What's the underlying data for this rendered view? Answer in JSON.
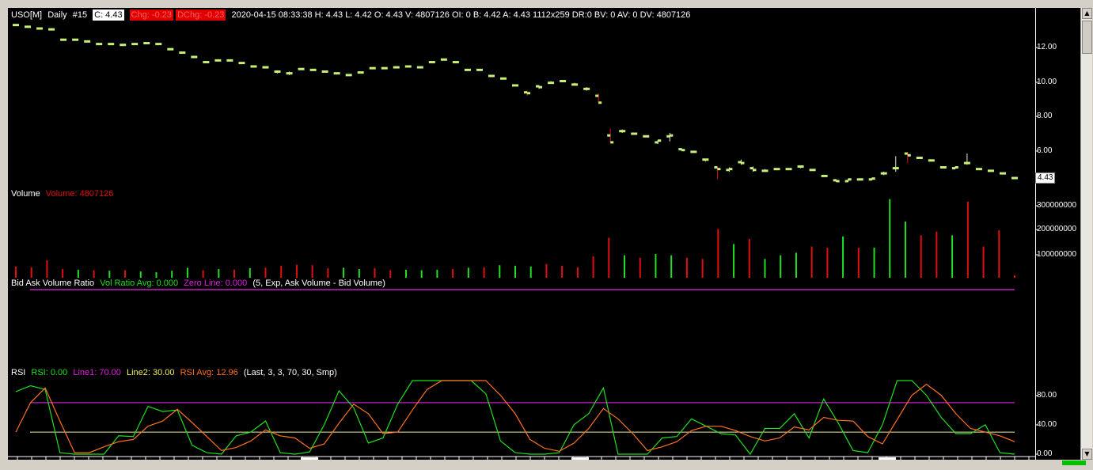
{
  "header": {
    "symbol": "USO[M]",
    "interval": "Daily",
    "number": "#15",
    "close": "C: 4.43",
    "chg": "Chg: -0.23",
    "dchg": "DChg: -0.23",
    "details": "2020-04-15 08:33:38 H: 4.43 L: 4.42 O: 4.43 V: 4807126 OI: 0 B: 4.42 A: 4.43 1112x259 DR:0 BV: 0 AV: 0 DV: 4807126"
  },
  "volume_header": {
    "title": "Volume",
    "value": "Volume: 4807126"
  },
  "bav_header": {
    "title": "Bid Ask Volume Ratio",
    "avg": "Vol Ratio Avg: 0.000",
    "zero": "Zero Line: 0.000",
    "params": "(5, Exp, Ask Volume - Bid Volume)"
  },
  "rsi_header": {
    "title": "RSI",
    "rsi": "RSI: 0.00",
    "line1": "Line1: 70.00",
    "line2": "Line2: 30.00",
    "avg": "RSI Avg: 12.96",
    "params": "(Last, 3, 3, 70, 30, Smp)"
  },
  "price_axis": {
    "labels": [
      "12.00",
      "10.00",
      "8.00",
      "6.00"
    ],
    "last": "4.43"
  },
  "volume_axis": {
    "labels": [
      "300000000",
      "200000000",
      "100000000"
    ]
  },
  "rsi_axis": {
    "labels": [
      "80.00",
      "40.00",
      "0.00"
    ]
  },
  "colors": {
    "bars": "#c8f078",
    "vol_up": "#20e020",
    "vol_down": "#e01010",
    "magenta": "#c020c0",
    "line2": "#f0f0a0",
    "rsi": "#20e020",
    "rsi_avg": "#ff7020"
  },
  "chart_data": [
    {
      "type": "ohlc",
      "name": "USO[M] Daily",
      "ylim": [
        4.0,
        13.6
      ],
      "values": [
        {
          "o": 13.3,
          "h": 13.35,
          "l": 13.25,
          "c": 13.3
        },
        {
          "o": 13.2,
          "h": 13.25,
          "l": 13.15,
          "c": 13.2
        },
        {
          "o": 13.1,
          "h": 13.15,
          "l": 13.05,
          "c": 13.1
        },
        {
          "o": 13.05,
          "h": 13.1,
          "l": 13.0,
          "c": 13.05
        },
        {
          "o": 12.45,
          "h": 12.5,
          "l": 12.4,
          "c": 12.45
        },
        {
          "o": 12.45,
          "h": 12.5,
          "l": 12.4,
          "c": 12.45
        },
        {
          "o": 12.35,
          "h": 12.4,
          "l": 12.3,
          "c": 12.35
        },
        {
          "o": 12.2,
          "h": 12.25,
          "l": 12.15,
          "c": 12.2
        },
        {
          "o": 12.2,
          "h": 12.25,
          "l": 12.15,
          "c": 12.2
        },
        {
          "o": 12.15,
          "h": 12.2,
          "l": 12.1,
          "c": 12.15
        },
        {
          "o": 12.2,
          "h": 12.25,
          "l": 12.15,
          "c": 12.2
        },
        {
          "o": 12.25,
          "h": 12.3,
          "l": 12.2,
          "c": 12.25
        },
        {
          "o": 12.2,
          "h": 12.25,
          "l": 12.15,
          "c": 12.2
        },
        {
          "o": 11.9,
          "h": 11.95,
          "l": 11.85,
          "c": 11.9
        },
        {
          "o": 11.7,
          "h": 11.75,
          "l": 11.65,
          "c": 11.7
        },
        {
          "o": 11.45,
          "h": 11.5,
          "l": 11.4,
          "c": 11.45
        },
        {
          "o": 11.15,
          "h": 11.2,
          "l": 11.1,
          "c": 11.15
        },
        {
          "o": 11.25,
          "h": 11.3,
          "l": 11.2,
          "c": 11.25
        },
        {
          "o": 11.25,
          "h": 11.3,
          "l": 11.2,
          "c": 11.25
        },
        {
          "o": 11.1,
          "h": 11.15,
          "l": 11.05,
          "c": 11.1
        },
        {
          "o": 10.9,
          "h": 10.95,
          "l": 10.85,
          "c": 10.9
        },
        {
          "o": 10.85,
          "h": 10.9,
          "l": 10.8,
          "c": 10.85
        },
        {
          "o": 10.6,
          "h": 10.65,
          "l": 10.5,
          "c": 10.6
        },
        {
          "o": 10.5,
          "h": 10.6,
          "l": 10.4,
          "c": 10.5
        },
        {
          "o": 10.75,
          "h": 10.8,
          "l": 10.7,
          "c": 10.75
        },
        {
          "o": 10.7,
          "h": 10.75,
          "l": 10.65,
          "c": 10.7
        },
        {
          "o": 10.6,
          "h": 10.65,
          "l": 10.55,
          "c": 10.6
        },
        {
          "o": 10.5,
          "h": 10.55,
          "l": 10.45,
          "c": 10.5
        },
        {
          "o": 10.4,
          "h": 10.45,
          "l": 10.35,
          "c": 10.4
        },
        {
          "o": 10.55,
          "h": 10.6,
          "l": 10.5,
          "c": 10.55
        },
        {
          "o": 10.8,
          "h": 10.85,
          "l": 10.75,
          "c": 10.8
        },
        {
          "o": 10.8,
          "h": 10.85,
          "l": 10.75,
          "c": 10.8
        },
        {
          "o": 10.85,
          "h": 10.9,
          "l": 10.8,
          "c": 10.85
        },
        {
          "o": 10.9,
          "h": 10.95,
          "l": 10.85,
          "c": 10.9
        },
        {
          "o": 10.85,
          "h": 10.9,
          "l": 10.8,
          "c": 10.85
        },
        {
          "o": 11.15,
          "h": 11.2,
          "l": 11.1,
          "c": 11.15
        },
        {
          "o": 11.3,
          "h": 11.35,
          "l": 11.25,
          "c": 11.3
        },
        {
          "o": 11.15,
          "h": 11.2,
          "l": 11.1,
          "c": 11.15
        },
        {
          "o": 10.7,
          "h": 10.75,
          "l": 10.65,
          "c": 10.7
        },
        {
          "o": 10.7,
          "h": 10.75,
          "l": 10.65,
          "c": 10.7
        },
        {
          "o": 10.35,
          "h": 10.4,
          "l": 10.3,
          "c": 10.35
        },
        {
          "o": 10.2,
          "h": 10.25,
          "l": 10.15,
          "c": 10.2
        },
        {
          "o": 9.8,
          "h": 9.85,
          "l": 9.75,
          "c": 9.8
        },
        {
          "o": 9.4,
          "h": 9.5,
          "l": 9.2,
          "c": 9.35
        },
        {
          "o": 9.75,
          "h": 9.8,
          "l": 9.6,
          "c": 9.7
        },
        {
          "o": 9.95,
          "h": 10.05,
          "l": 9.9,
          "c": 9.95
        },
        {
          "o": 10.05,
          "h": 10.1,
          "l": 10.0,
          "c": 10.05
        },
        {
          "o": 9.85,
          "h": 9.95,
          "l": 9.8,
          "c": 9.85
        },
        {
          "o": 9.6,
          "h": 9.7,
          "l": 9.5,
          "c": 9.6
        },
        {
          "o": 9.2,
          "h": 9.35,
          "l": 8.8,
          "c": 8.8
        },
        {
          "o": 6.9,
          "h": 7.3,
          "l": 6.5,
          "c": 6.5
        },
        {
          "o": 7.15,
          "h": 7.25,
          "l": 7.05,
          "c": 7.15
        },
        {
          "o": 7.0,
          "h": 7.05,
          "l": 6.95,
          "c": 7.0
        },
        {
          "o": 6.85,
          "h": 6.9,
          "l": 6.8,
          "c": 6.85
        },
        {
          "o": 6.5,
          "h": 6.65,
          "l": 6.4,
          "c": 6.6
        },
        {
          "o": 6.85,
          "h": 7.05,
          "l": 6.55,
          "c": 6.9
        },
        {
          "o": 6.1,
          "h": 6.15,
          "l": 6.0,
          "c": 6.05
        },
        {
          "o": 5.95,
          "h": 6.0,
          "l": 5.9,
          "c": 5.95
        },
        {
          "o": 5.5,
          "h": 5.55,
          "l": 5.4,
          "c": 5.5
        },
        {
          "o": 5.05,
          "h": 5.1,
          "l": 4.35,
          "c": 4.95
        },
        {
          "o": 4.9,
          "h": 5.05,
          "l": 4.8,
          "c": 4.95
        },
        {
          "o": 5.35,
          "h": 5.5,
          "l": 5.2,
          "c": 5.3
        },
        {
          "o": 5.0,
          "h": 5.1,
          "l": 4.8,
          "c": 4.9
        },
        {
          "o": 4.85,
          "h": 4.95,
          "l": 4.8,
          "c": 4.85
        },
        {
          "o": 4.95,
          "h": 5.0,
          "l": 4.9,
          "c": 4.95
        },
        {
          "o": 4.95,
          "h": 5.0,
          "l": 4.9,
          "c": 4.95
        },
        {
          "o": 5.1,
          "h": 5.15,
          "l": 5.0,
          "c": 5.1
        },
        {
          "o": 4.9,
          "h": 4.95,
          "l": 4.85,
          "c": 4.9
        },
        {
          "o": 4.55,
          "h": 4.6,
          "l": 4.5,
          "c": 4.55
        },
        {
          "o": 4.3,
          "h": 4.35,
          "l": 4.2,
          "c": 4.25
        },
        {
          "o": 4.25,
          "h": 4.4,
          "l": 4.2,
          "c": 4.35
        },
        {
          "o": 4.35,
          "h": 4.4,
          "l": 4.3,
          "c": 4.35
        },
        {
          "o": 4.35,
          "h": 4.45,
          "l": 4.3,
          "c": 4.4
        },
        {
          "o": 4.7,
          "h": 4.8,
          "l": 4.6,
          "c": 4.7
        },
        {
          "o": 5.0,
          "h": 5.7,
          "l": 4.8,
          "c": 5.0
        },
        {
          "o": 5.85,
          "h": 5.95,
          "l": 5.3,
          "c": 5.75
        },
        {
          "o": 5.6,
          "h": 5.65,
          "l": 5.55,
          "c": 5.6
        },
        {
          "o": 5.45,
          "h": 5.5,
          "l": 5.4,
          "c": 5.45
        },
        {
          "o": 5.05,
          "h": 5.1,
          "l": 5.0,
          "c": 5.05
        },
        {
          "o": 5.0,
          "h": 5.1,
          "l": 4.95,
          "c": 5.05
        },
        {
          "o": 5.3,
          "h": 5.85,
          "l": 5.2,
          "c": 5.3
        },
        {
          "o": 4.95,
          "h": 5.0,
          "l": 4.9,
          "c": 4.95
        },
        {
          "o": 4.85,
          "h": 4.9,
          "l": 4.8,
          "c": 4.85
        },
        {
          "o": 4.7,
          "h": 4.75,
          "l": 4.65,
          "c": 4.7
        },
        {
          "o": 4.43,
          "h": 4.43,
          "l": 4.42,
          "c": 4.43
        }
      ]
    },
    {
      "type": "bar",
      "name": "Volume",
      "ylim": [
        0,
        330000000
      ],
      "values": [
        [
          45000000,
          "d"
        ],
        [
          42000000,
          "d"
        ],
        [
          70000000,
          "d"
        ],
        [
          35000000,
          "d"
        ],
        [
          32000000,
          "u"
        ],
        [
          30000000,
          "d"
        ],
        [
          28000000,
          "u"
        ],
        [
          30000000,
          "d"
        ],
        [
          25000000,
          "u"
        ],
        [
          22000000,
          "u"
        ],
        [
          28000000,
          "u"
        ],
        [
          40000000,
          "u"
        ],
        [
          30000000,
          "d"
        ],
        [
          35000000,
          "u"
        ],
        [
          32000000,
          "d"
        ],
        [
          38000000,
          "u"
        ],
        [
          40000000,
          "d"
        ],
        [
          48000000,
          "d"
        ],
        [
          52000000,
          "d"
        ],
        [
          50000000,
          "d"
        ],
        [
          38000000,
          "d"
        ],
        [
          40000000,
          "u"
        ],
        [
          35000000,
          "u"
        ],
        [
          38000000,
          "d"
        ],
        [
          30000000,
          "d"
        ],
        [
          32000000,
          "u"
        ],
        [
          30000000,
          "u"
        ],
        [
          32000000,
          "u"
        ],
        [
          35000000,
          "d"
        ],
        [
          40000000,
          "u"
        ],
        [
          42000000,
          "d"
        ],
        [
          50000000,
          "u"
        ],
        [
          48000000,
          "u"
        ],
        [
          45000000,
          "u"
        ],
        [
          55000000,
          "d"
        ],
        [
          48000000,
          "d"
        ],
        [
          42000000,
          "d"
        ],
        [
          85000000,
          "d"
        ],
        [
          160000000,
          "d"
        ],
        [
          90000000,
          "u"
        ],
        [
          80000000,
          "d"
        ],
        [
          95000000,
          "u"
        ],
        [
          90000000,
          "u"
        ],
        [
          80000000,
          "d"
        ],
        [
          75000000,
          "d"
        ],
        [
          195000000,
          "d"
        ],
        [
          135000000,
          "u"
        ],
        [
          155000000,
          "d"
        ],
        [
          75000000,
          "u"
        ],
        [
          90000000,
          "u"
        ],
        [
          100000000,
          "u"
        ],
        [
          125000000,
          "d"
        ],
        [
          120000000,
          "d"
        ],
        [
          165000000,
          "u"
        ],
        [
          120000000,
          "d"
        ],
        [
          120000000,
          "u"
        ],
        [
          315000000,
          "u"
        ],
        [
          225000000,
          "u"
        ],
        [
          170000000,
          "d"
        ],
        [
          185000000,
          "d"
        ],
        [
          170000000,
          "u"
        ],
        [
          305000000,
          "d"
        ],
        [
          125000000,
          "d"
        ],
        [
          190000000,
          "d"
        ],
        [
          10000000,
          "d"
        ]
      ]
    },
    {
      "type": "line",
      "name": "RSI",
      "ylim": [
        0,
        100
      ],
      "series": [
        {
          "name": "RSI",
          "values": [
            85,
            93,
            88,
            2,
            0,
            0,
            0,
            25,
            24,
            65,
            58,
            60,
            12,
            2,
            0,
            25,
            30,
            45,
            2,
            0,
            3,
            40,
            86,
            63,
            15,
            22,
            68,
            100,
            100,
            100,
            100,
            100,
            82,
            18,
            2,
            0,
            0,
            2,
            40,
            55,
            90,
            0,
            0,
            0,
            22,
            24,
            48,
            38,
            28,
            26,
            0,
            35,
            35,
            55,
            22,
            75,
            42,
            5,
            2,
            40,
            100,
            100,
            80,
            50,
            28,
            28,
            40,
            2,
            0
          ]
        },
        {
          "name": "RSI Avg",
          "values": [
            30,
            70,
            90,
            45,
            2,
            2,
            10,
            17,
            20,
            38,
            45,
            61,
            43,
            24,
            5,
            9,
            18,
            33,
            25,
            22,
            8,
            14,
            42,
            68,
            55,
            28,
            30,
            60,
            88,
            100,
            100,
            100,
            100,
            80,
            55,
            20,
            8,
            4,
            15,
            35,
            62,
            48,
            28,
            5,
            10,
            17,
            32,
            38,
            38,
            32,
            24,
            18,
            22,
            37,
            33,
            50,
            46,
            45,
            24,
            14,
            47,
            80,
            95,
            80,
            55,
            35,
            30,
            25,
            17
          ]
        }
      ],
      "lines": [
        {
          "name": "Line1",
          "value": 70
        },
        {
          "name": "Line2",
          "value": 30
        }
      ]
    }
  ]
}
